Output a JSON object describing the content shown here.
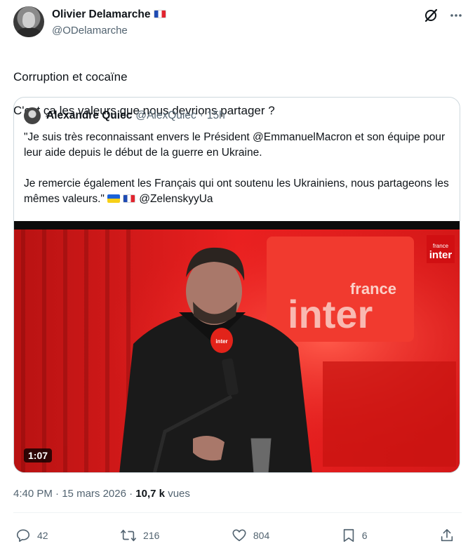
{
  "author": {
    "display_name": "Olivier Delamarche",
    "handle": "@ODelamarche",
    "flag": "flag-fr-icon"
  },
  "tweet": {
    "line1": "Corruption et cocaïne",
    "line2": "C'est ça les valeurs que nous devrions partager ?"
  },
  "quote": {
    "display_name": "Alexandre Quiec",
    "handle": "@AlexQuiec",
    "separator": "·",
    "time": "15h",
    "para1": "\"Je suis très reconnaissant envers le Président @EmmanuelMacron et son équipe pour leur aide depuis le début de la guerre en Ukraine.",
    "para2_a": "Je remercie également les Français qui ont soutenu les Ukrainiens, nous partageons les mêmes valeurs.\" ",
    "para2_mention": "@ZelenskyyUa",
    "media": {
      "duration": "1:07",
      "logo_small_top": "france",
      "logo_small_bottom": "inter",
      "logo_wall_top": "france",
      "logo_wall_bottom": "inter",
      "mic_label": "inter"
    }
  },
  "meta": {
    "time": "4:40 PM",
    "sep1": "·",
    "date": "15 mars 2026",
    "sep2": "·",
    "views_count": "10,7 k",
    "views_label": "vues"
  },
  "actions": {
    "replies": "42",
    "reposts": "216",
    "likes": "804",
    "bookmarks": "6"
  },
  "colors": {
    "text": "#0f1419",
    "secondary": "#536471",
    "border": "#cfd9de",
    "studio_red": "#e51d1d"
  }
}
